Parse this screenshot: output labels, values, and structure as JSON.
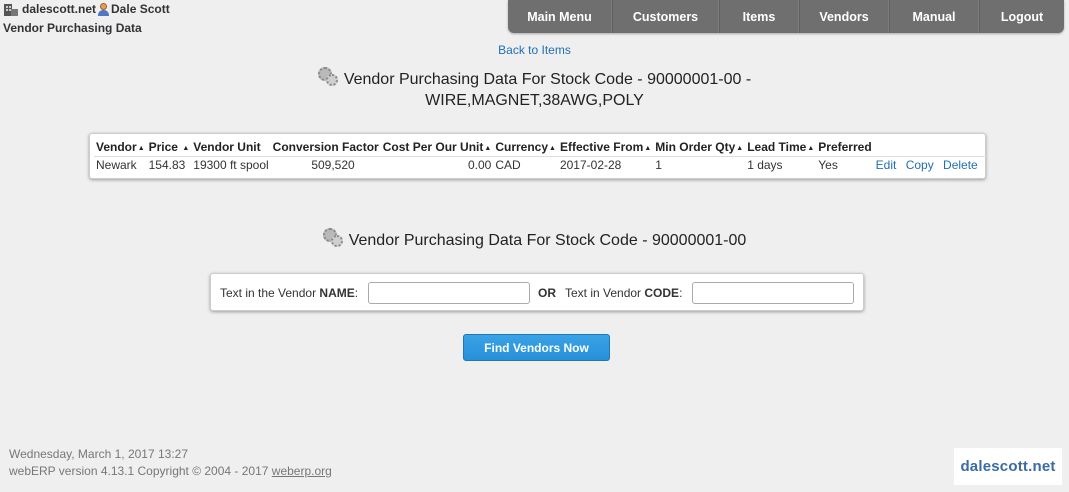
{
  "header": {
    "company": "dalescott.net",
    "user": "Dale Scott",
    "page_name": "Vendor Purchasing Data"
  },
  "menu": [
    "Main Menu",
    "Customers",
    "Items",
    "Vendors",
    "Manual",
    "Logout"
  ],
  "back_link": "Back to Items",
  "title1": {
    "line1": "Vendor Purchasing Data For Stock Code - 90000001-00 -",
    "line2": "WIRE,MAGNET,38AWG,POLY"
  },
  "purchasing_table": {
    "columns": [
      "Vendor",
      "Price",
      "Vendor Unit",
      "Conversion Factor",
      "Cost Per Our Unit",
      "Currency",
      "Effective From",
      "Min Order Qty",
      "Lead Time",
      "Preferred"
    ],
    "rows": [
      {
        "vendor": "Newark",
        "price": "154.83",
        "vendor_unit": "19300 ft spool",
        "conversion_factor": "509,520",
        "cost_per_unit": "0.00",
        "currency": "CAD",
        "effective_from": "2017-02-28",
        "min_order_qty": "1",
        "lead_time": "1 days",
        "preferred": "Yes",
        "actions": [
          "Edit",
          "Copy",
          "Delete"
        ]
      }
    ]
  },
  "title2": "Vendor Purchasing Data For Stock Code - 90000001-00",
  "search": {
    "name_label_pre": "Text in the Vendor ",
    "name_label_bold": "NAME",
    "name_label_post": ":",
    "or_label": "OR",
    "code_label_pre": "Text in Vendor ",
    "code_label_bold": "CODE",
    "code_label_post": ":",
    "name_value": "",
    "code_value": ""
  },
  "find_button": "Find Vendors Now",
  "footer": {
    "datetime": "Wednesday, March 1, 2017 13:27",
    "version": "webERP version 4.13.1 Copyright © 2004 - 2017 ",
    "link": "weberp.org"
  },
  "logo_text": "dalescott.net",
  "colors": {
    "menu_bg": "#6f6f6f",
    "link": "#1f6fb5",
    "button": "#2e96dd"
  },
  "icons": [
    "company-icon",
    "user-icon",
    "gear-icon"
  ]
}
